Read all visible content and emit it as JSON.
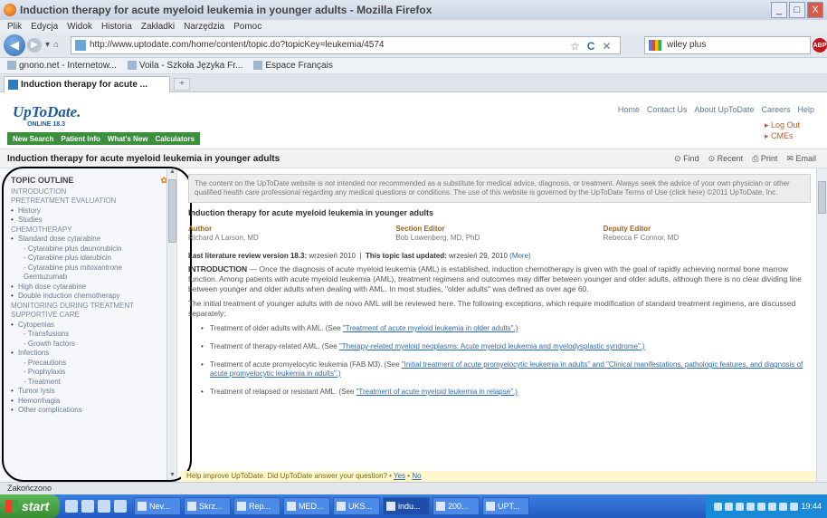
{
  "window": {
    "title": "Induction therapy for acute myeloid leukemia in younger adults - Mozilla Firefox",
    "buttons": [
      "_",
      "□",
      "X"
    ]
  },
  "menubar": [
    "Plik",
    "Edycja",
    "Widok",
    "Historia",
    "Zakładki",
    "Narzędzia",
    "Pomoc"
  ],
  "navbar": {
    "url": "http://www.uptodate.com/home/content/topic.do?topicKey=leukemia/4574",
    "search_value": "wiley plus",
    "back_icon": "arrow-left-icon",
    "reload_icon": "reload-icon"
  },
  "bookmarks": [
    "gnono.net - Internetow...",
    "Voila - Szkoła Języka Fr...",
    "Espace Français"
  ],
  "tab": {
    "label": "Induction therapy for acute ...",
    "new_tab": "+"
  },
  "site": {
    "logo": "UpToDate.",
    "logo_sub": "ONLINE 18.3",
    "top_links": [
      "Home",
      "Contact Us",
      "About UpToDate",
      "Careers",
      "Help"
    ],
    "user_links": [
      "Log Out",
      "CMEs"
    ],
    "nav": [
      "New Search",
      "Patient Info",
      "What's New",
      "Calculators"
    ],
    "page_title": "Induction therapy for acute myeloid leukemia in younger adults",
    "tools": [
      "Find",
      "Recent",
      "Print",
      "Email"
    ]
  },
  "outline": {
    "head": "TOPIC OUTLINE",
    "items": [
      {
        "text": "INTRODUCTION",
        "level": 0
      },
      {
        "text": "PRETREATMENT EVALUATION",
        "level": 0
      },
      {
        "text": "History",
        "level": 1
      },
      {
        "text": "Studies",
        "level": 1
      },
      {
        "text": "CHEMOTHERAPY",
        "level": 0
      },
      {
        "text": "Standard dose cytarabine",
        "level": 1
      },
      {
        "text": "- Cytarabine plus daunorubicin",
        "level": 2
      },
      {
        "text": "- Cytarabine plus idarubicin",
        "level": 2
      },
      {
        "text": "- Cytarabine plus mitoxantrone",
        "level": 2
      },
      {
        "text": "Gemtuzumab",
        "level": 2
      },
      {
        "text": "High dose cytarabine",
        "level": 1
      },
      {
        "text": "Double induction chemotherapy",
        "level": 1
      },
      {
        "text": "MONITORING DURING TREATMENT",
        "level": 0
      },
      {
        "text": "SUPPORTIVE CARE",
        "level": 0
      },
      {
        "text": "Cytopenias",
        "level": 1
      },
      {
        "text": "- Transfusions",
        "level": 2
      },
      {
        "text": "- Growth factors",
        "level": 2
      },
      {
        "text": "Infections",
        "level": 1
      },
      {
        "text": "- Precautions",
        "level": 2
      },
      {
        "text": "- Prophylaxis",
        "level": 2
      },
      {
        "text": "- Treatment",
        "level": 2
      },
      {
        "text": "Tumor lysis",
        "level": 1
      },
      {
        "text": "Hemorrhagia",
        "level": 1
      },
      {
        "text": "Other complications",
        "level": 1
      }
    ]
  },
  "article": {
    "disclaimer": "The content on the UpToDate website is not intended nor recommended as a substitute for medical advice, diagnosis, or treatment. Always seek the advice of your own physician or other qualified health care professional regarding any medical questions or conditions. The use of this website is governed by the UpToDate Terms of Use (click here) ©2011 UpToDate, Inc.",
    "title": "Induction therapy for acute myeloid leukemia in younger adults",
    "editors": [
      {
        "label": "Author",
        "name": "Richard A Larson, MD"
      },
      {
        "label": "Section Editor",
        "name": "Bob Lowenberg, MD, PhD"
      },
      {
        "label": "Deputy Editor",
        "name": "Rebecca F Connor, MD"
      }
    ],
    "review_label": "Last literature review version 18.3:",
    "review_date": "wrzesień 2010",
    "updated_label": "This topic last updated:",
    "updated_date": "wrzesień 29, 2010",
    "more": "(More)",
    "intro_label": "INTRODUCTION",
    "intro_text": "— Once the diagnosis of acute myeloid leukemia (AML) is established, induction chemotherapy is given with the goal of rapidly achieving normal bone marrow function. Among patients with acute myeloid leukemia (AML), treatment regimens and outcomes may differ between younger and older adults, although there is no clear dividing line between younger and older adults when dealing with AML. In most studies, \"older adults\" was defined as over age 60.",
    "second_para": "The initial treatment of younger adults with de novo AML will be reviewed here. The following exceptions, which require modification of standard treatment regimens, are discussed separately:",
    "bullets": [
      {
        "text": "Treatment of older adults with AML. (See ",
        "link": "\"Treatment of acute myeloid leukemia in older adults\".)"
      },
      {
        "text": "Treatment of therapy-related AML. (See ",
        "link": "\"Therapy-related myeloid neoplasms: Acute myeloid leukemia and myelodysplastic syndrome\".)"
      },
      {
        "text": "Treatment of acute promyelocytic leukemia (FAB M3). (See ",
        "link": "\"Initial treatment of acute promyelocytic leukemia in adults\" and \"Clinical manifestations, pathologic features, and diagnosis of acute promyelocytic leukemia in adults\".)"
      },
      {
        "text": "Treatment of relapsed or resistant AML. (See ",
        "link": "\"Treatment of acute myeloid leukemia in relapse\".)"
      }
    ],
    "feedback": "Help improve UpToDate. Did UpToDate answer your question?",
    "feedback_yes": "Yes",
    "feedback_no": "No"
  },
  "statusbar": "Zakończono",
  "taskbar": {
    "start": "start",
    "tasks": [
      "Nev...",
      "Skrz...",
      "Rep...",
      "MED...",
      "UKS...",
      "indu...",
      "200...",
      "UPT..."
    ],
    "clock": "19:44"
  }
}
